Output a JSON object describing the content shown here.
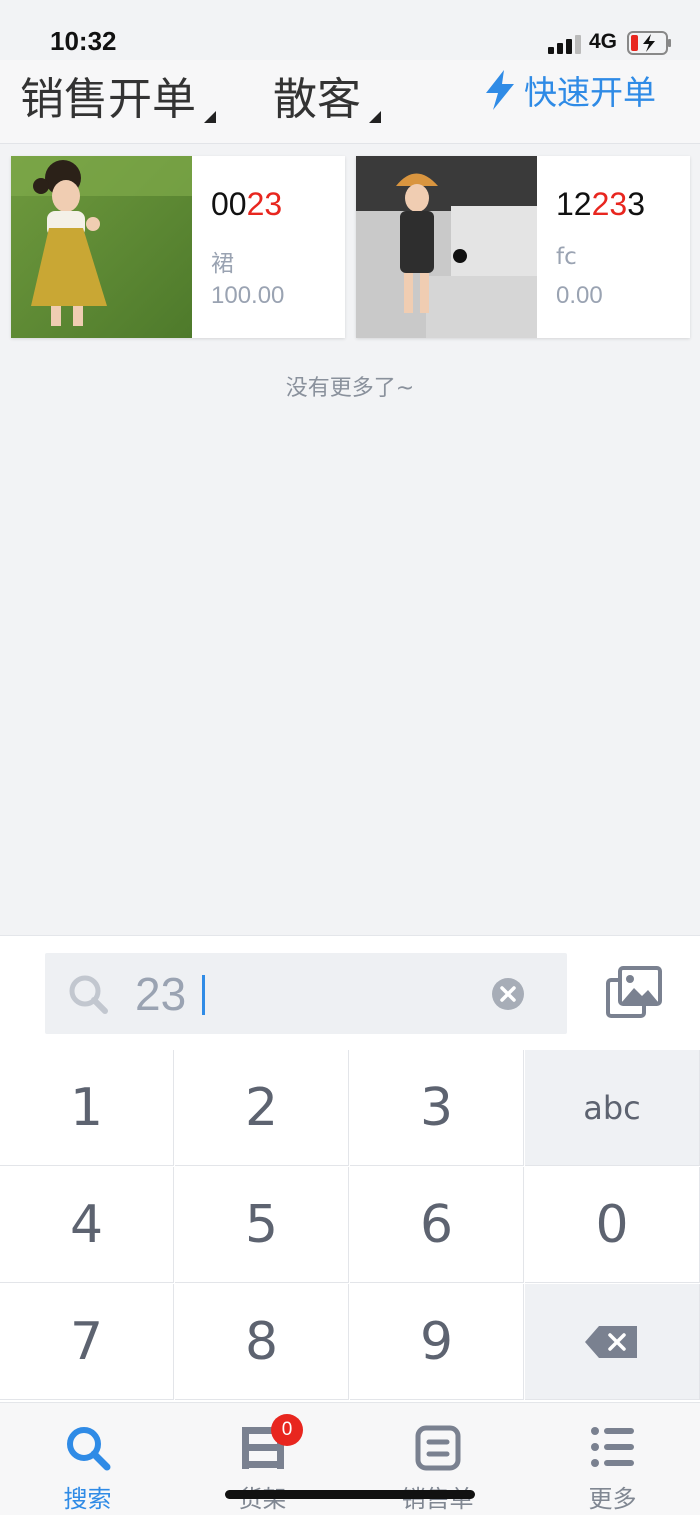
{
  "status_bar": {
    "time": "10:32",
    "network": "4G"
  },
  "header": {
    "type_selector": "销售开单",
    "customer_selector": "散客",
    "quick_order": "快速开单"
  },
  "products": [
    {
      "code_prefix": "00",
      "code_match": "23",
      "code_suffix": "",
      "name": "裙",
      "price": "100.00"
    },
    {
      "code_prefix": "12",
      "code_match": "23",
      "code_suffix": "3",
      "name": "fc",
      "price": "0.00"
    }
  ],
  "list_end_text": "没有更多了~",
  "search": {
    "value": "23"
  },
  "keypad": {
    "k1": "1",
    "k2": "2",
    "k3": "3",
    "abc": "abc",
    "k4": "4",
    "k5": "5",
    "k6": "6",
    "k0": "0",
    "k7": "7",
    "k8": "8",
    "k9": "9"
  },
  "tabbar": {
    "tabs": [
      {
        "label": "搜索",
        "icon": "search-icon"
      },
      {
        "label": "货架",
        "icon": "shelf-icon"
      },
      {
        "label": "销售单",
        "icon": "sales-order-icon"
      },
      {
        "label": "更多",
        "icon": "more-list-icon"
      }
    ],
    "shelf_badge": "0"
  },
  "colors": {
    "accent": "#2f8be6",
    "highlight": "#e8261f",
    "muted": "#9aa3b2"
  }
}
